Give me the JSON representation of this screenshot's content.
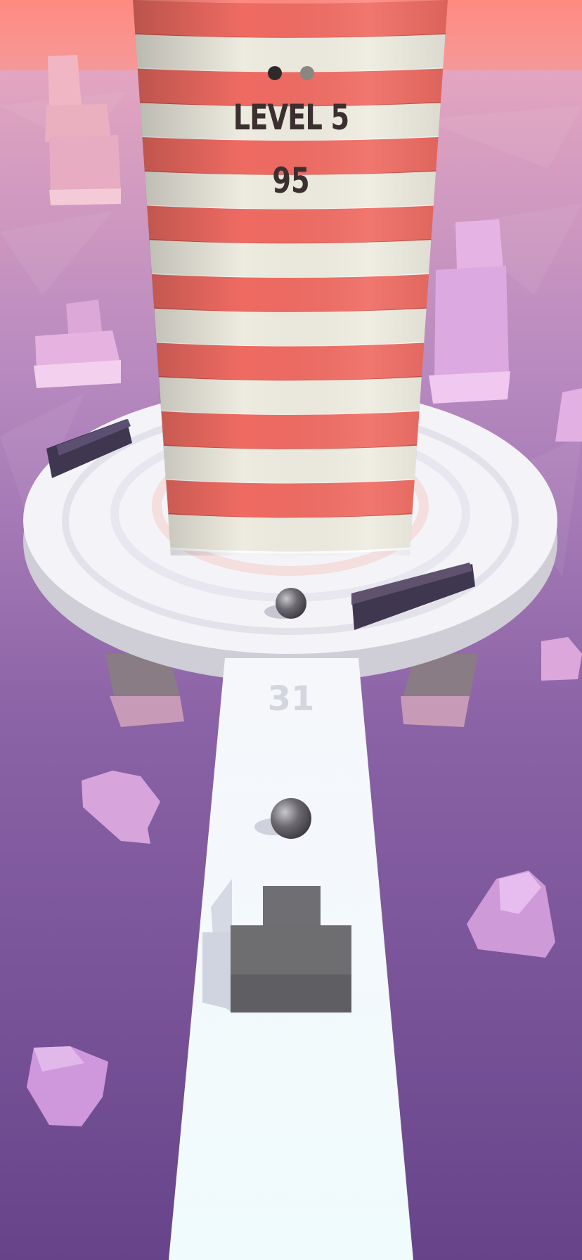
{
  "hud": {
    "level_label": "LEVEL 5",
    "score": "95",
    "progress_dots": [
      {
        "state": "filled",
        "color": "#2f2a2a"
      },
      {
        "state": "empty",
        "color": "#8a8680"
      }
    ]
  },
  "path": {
    "counter": "31"
  },
  "colors": {
    "sky": "#ff8c80",
    "ground_top": "#d99ab8",
    "ground_bottom": "#6b4a8a",
    "tower_red": "#ef6b62",
    "tower_white": "#eeece0",
    "platform": "#f4f4f8",
    "obstacle": "#5a4a64",
    "block": "#6f6e70",
    "rock": "#d8a8e0"
  }
}
